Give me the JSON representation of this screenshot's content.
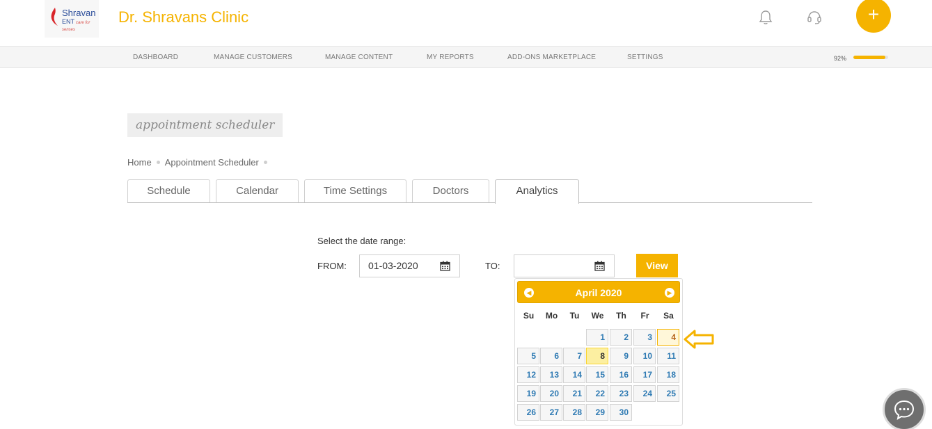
{
  "header": {
    "logo_text": "Shravan",
    "logo_sub": "ENT",
    "logo_tagline": "care for senses",
    "clinic_title": "Dr. Shravans Clinic",
    "plus_label": "+"
  },
  "nav": {
    "items": [
      "DASHBOARD",
      "MANAGE CUSTOMERS",
      "MANAGE CONTENT",
      "MY REPORTS",
      "ADD-ONS MARKETPLACE",
      "SETTINGS"
    ],
    "progress_text": "92%",
    "progress_value": 0.92
  },
  "page": {
    "title": "appointment scheduler"
  },
  "breadcrumb": [
    "Home",
    "Appointment Scheduler"
  ],
  "tabs": [
    "Schedule",
    "Calendar",
    "Time Settings",
    "Doctors",
    "Analytics"
  ],
  "active_tab": "Analytics",
  "form": {
    "select_label": "Select the date range:",
    "from_label": "FROM:",
    "from_value": "01-03-2020",
    "to_label": "TO:",
    "to_value": "",
    "view_label": "View"
  },
  "datepicker": {
    "month_title": "April 2020",
    "prev_icon": "chevron-left",
    "next_icon": "chevron-right",
    "weekdays": [
      "Su",
      "Mo",
      "Tu",
      "We",
      "Th",
      "Fr",
      "Sa"
    ],
    "weeks": [
      [
        "",
        "",
        "",
        "1",
        "2",
        "3",
        "4"
      ],
      [
        "5",
        "6",
        "7",
        "8",
        "9",
        "10",
        "11"
      ],
      [
        "12",
        "13",
        "14",
        "15",
        "16",
        "17",
        "18"
      ],
      [
        "19",
        "20",
        "21",
        "22",
        "23",
        "24",
        "25"
      ],
      [
        "26",
        "27",
        "28",
        "29",
        "30",
        "",
        ""
      ]
    ],
    "today": "8",
    "highlighted": "4"
  },
  "colors": {
    "accent": "#f5b300",
    "link": "#2e7ab3"
  }
}
